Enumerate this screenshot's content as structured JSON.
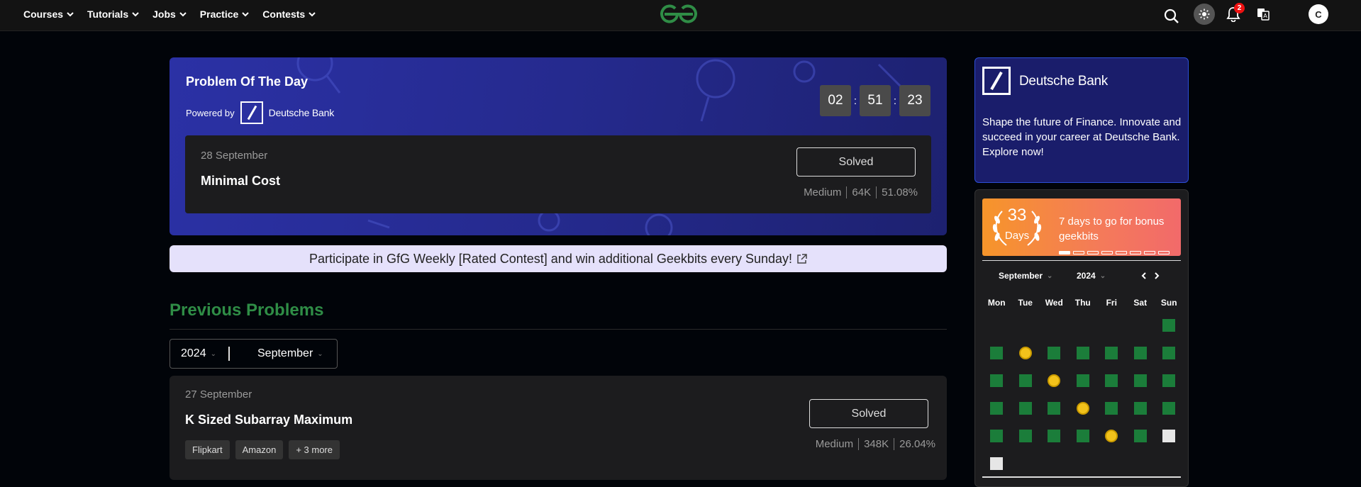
{
  "nav": {
    "items": [
      {
        "label": "Courses"
      },
      {
        "label": "Tutorials"
      },
      {
        "label": "Jobs"
      },
      {
        "label": "Practice"
      },
      {
        "label": "Contests"
      }
    ],
    "notification_count": "2",
    "avatar_initial": "C"
  },
  "potd": {
    "title": "Problem Of The Day",
    "powered_by": "Powered by",
    "sponsor": "Deutsche Bank",
    "timer": {
      "h": "02",
      "m": "51",
      "s": "23"
    },
    "sep": ":",
    "date": "28 September",
    "problem": "Minimal Cost",
    "status": "Solved",
    "difficulty": "Medium",
    "submissions": "64K",
    "accuracy": "51.08%"
  },
  "banner": {
    "text": "Participate in GfG Weekly [Rated Contest] and win additional Geekbits every Sunday!"
  },
  "previous": {
    "title": "Previous Problems",
    "year": "2024",
    "month": "September",
    "problems": [
      {
        "date": "27 September",
        "name": "K Sized Subarray Maximum",
        "status": "Solved",
        "difficulty": "Medium",
        "submissions": "348K",
        "accuracy": "26.04%",
        "tags": [
          "Flipkart",
          "Amazon",
          "+ 3 more"
        ]
      }
    ]
  },
  "sidebar": {
    "ad": {
      "name": "Deutsche Bank",
      "text": "Shape the future of Finance. Innovate and succeed in your career at Deutsche Bank. Explore now!"
    },
    "streak": {
      "count": "33",
      "unit": "Days",
      "message": "7 days to go for bonus geekbits",
      "progress_filled": 1,
      "progress_total": 8
    },
    "calendar": {
      "month": "September",
      "year": "2024",
      "weekdays": [
        "Mon",
        "Tue",
        "Wed",
        "Thu",
        "Fri",
        "Sat",
        "Sun"
      ],
      "weeks": [
        [
          "",
          "",
          "",
          "",
          "",
          "",
          "solved"
        ],
        [
          "solved",
          "streak",
          "solved",
          "solved",
          "solved",
          "solved",
          "solved"
        ],
        [
          "solved",
          "solved",
          "streak",
          "solved",
          "solved",
          "solved",
          "solved"
        ],
        [
          "solved",
          "solved",
          "solved",
          "streak",
          "solved",
          "solved",
          "solved"
        ],
        [
          "solved",
          "solved",
          "solved",
          "solved",
          "streak",
          "solved",
          "empty"
        ],
        [
          "empty",
          "",
          "",
          "",
          "",
          "",
          ""
        ]
      ]
    }
  },
  "colors": {
    "brand_green": "#2f8d46",
    "potd_bg": "#2b31a5",
    "banner_bg": "#e5e1fb",
    "streak_orange": "#f6952a",
    "solved_green": "#1b7d3a",
    "streak_yellow": "#f2c21b"
  }
}
